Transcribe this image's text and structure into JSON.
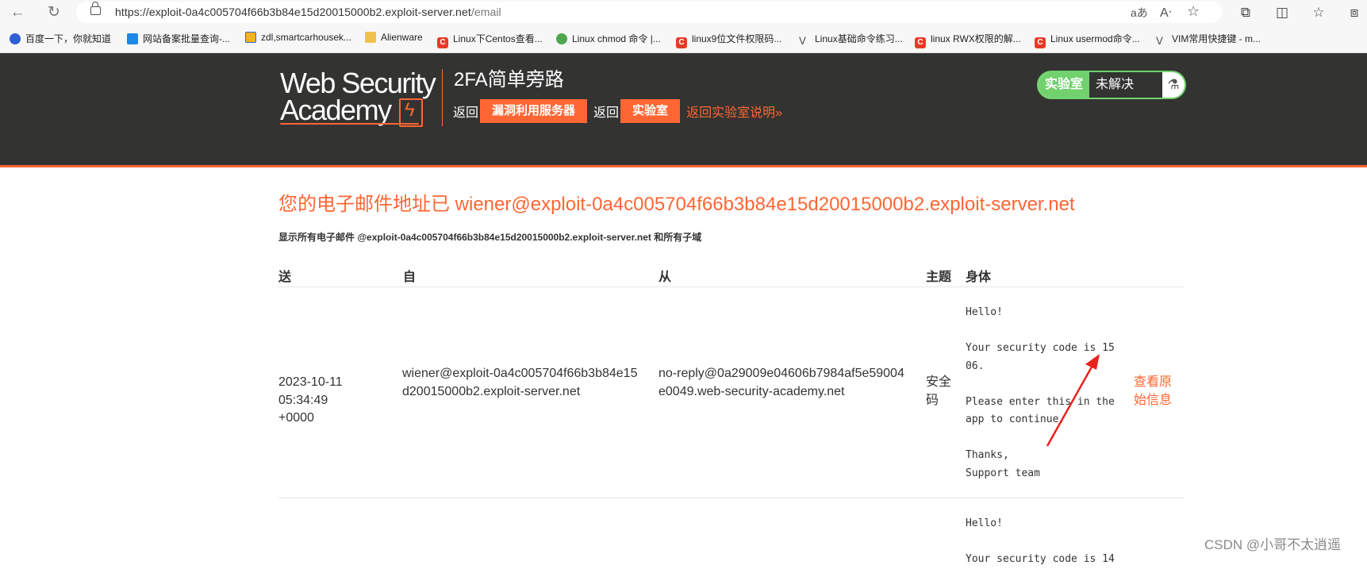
{
  "browser": {
    "url_host": "https://exploit-0a4c005704f66b3b84e15d20015000b2.exploit-server.net",
    "url_path": "/email",
    "bookmarks": [
      {
        "label": "百度一下，你就知道",
        "icon": "baidu-paw-icon"
      },
      {
        "label": "网站备案批量查询-...",
        "icon": "bracket-icon"
      },
      {
        "label": "zdl,smartcarhousek...",
        "icon": "flag-icon"
      },
      {
        "label": "Alienware",
        "icon": "folder-icon"
      },
      {
        "label": "Linux下Centos查看...",
        "icon": "csdn-icon"
      },
      {
        "label": "Linux chmod 命令 |...",
        "icon": "runoob-icon"
      },
      {
        "label": "linux9位文件权限码...",
        "icon": "csdn-icon"
      },
      {
        "label": "Linux基础命令练习...",
        "icon": "vim-icon"
      },
      {
        "label": "linux RWX权限的解...",
        "icon": "csdn-icon"
      },
      {
        "label": "Linux usermod命令...",
        "icon": "csdn-icon"
      },
      {
        "label": "VIM常用快捷键 - m...",
        "icon": "vim-icon"
      }
    ]
  },
  "lab": {
    "logo_line1": "Web Security",
    "logo_line2": "Academy",
    "title": "2FA简单旁路",
    "back_text_1": "返回",
    "exploit_server_button": "漏洞利用服务器",
    "back_text_2": "返回",
    "lab_button": "实验室",
    "description_link": "返回实验室说明»",
    "status_label": "实验室",
    "status_value": "未解决",
    "status_icon": "flask-icon",
    "accent_color": "#ff6633",
    "status_color": "#70d16d"
  },
  "email": {
    "heading": "您的电子邮件地址已 wiener@exploit-0a4c005704f66b3b84e15d20015000b2.exploit-server.net",
    "subheading": "显示所有电子邮件 @exploit-0a4c005704f66b3b84e15d20015000b2.exploit-server.net 和所有子域",
    "columns": {
      "sent": "送",
      "to": "自",
      "from": "从",
      "subject": "主题",
      "body": "身体"
    },
    "rows": [
      {
        "sent": "2023-10-11 05:34:49 +0000",
        "to": "wiener@exploit-0a4c005704f66b3b84e15d20015000b2.exploit-server.net",
        "from": "no-reply@0a29009e04606b7984af5e59004e0049.web-security-academy.net",
        "subject": "安全码",
        "body": "Hello!\n\nYour security code is 15\n06.\n\nPlease enter this in the\napp to continue.\n\nThanks,\nSupport team",
        "view_raw": "查看原始信息"
      },
      {
        "body_partial": "Hello!\n\nYour security code is 14"
      }
    ]
  },
  "watermark": "CSDN @小哥不太逍遥"
}
